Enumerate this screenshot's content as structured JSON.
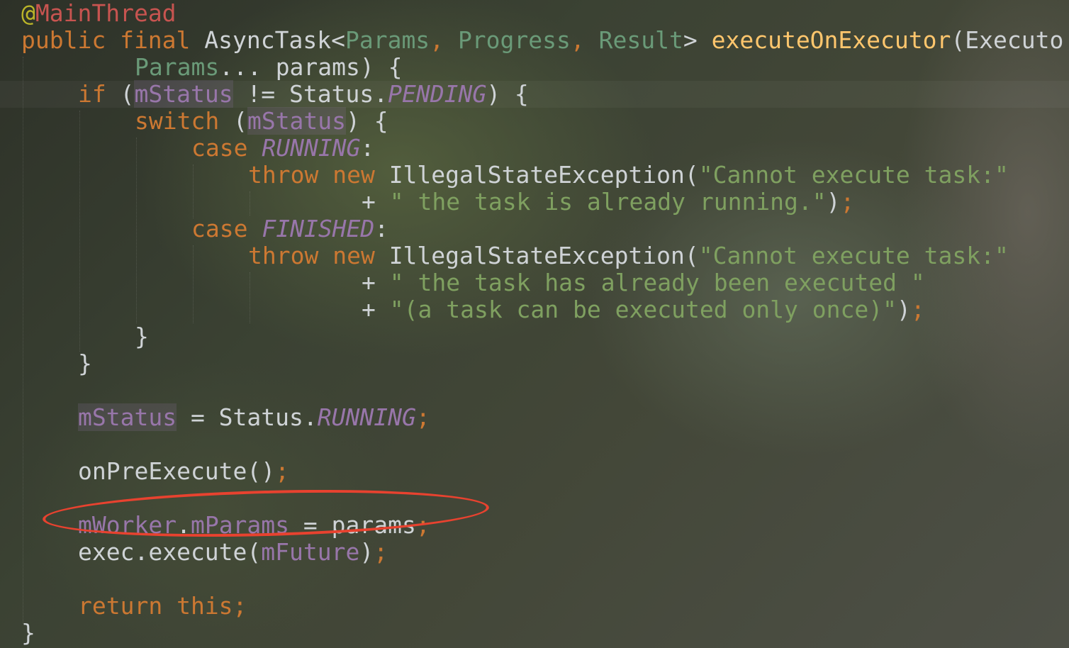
{
  "code": {
    "annotation_at": "@",
    "annotation_name": "MainThread",
    "l2": {
      "kw1": "public final ",
      "type": "AsyncTask<",
      "g1": "Params",
      "c1": ", ",
      "g2": "Progress",
      "c2": ", ",
      "g3": "Result",
      "close": "> ",
      "method": "executeOnExecutor",
      "rest": "(Executo"
    },
    "l3": {
      "g": "Params",
      "rest": "... params) {"
    },
    "l4": {
      "kw": "if ",
      "p1": "(",
      "field": "mStatus",
      "mid": " != Status.",
      "const": "PENDING",
      "end": ") {"
    },
    "l5": {
      "kw": "switch ",
      "p1": "(",
      "field": "mStatus",
      "end": ") {"
    },
    "l6": {
      "kw": "case ",
      "const": "RUNNING",
      "end": ":"
    },
    "l7": {
      "kw": "throw new ",
      "type": "IllegalStateException(",
      "str": "\"Cannot execute task:\""
    },
    "l8": {
      "plus": "+ ",
      "str": "\" the task is already running.\"",
      "end": ")",
      "semi": ";"
    },
    "l9": {
      "kw": "case ",
      "const": "FINISHED",
      "end": ":"
    },
    "l10": {
      "kw": "throw new ",
      "type": "IllegalStateException(",
      "str": "\"Cannot execute task:\""
    },
    "l11": {
      "plus": "+ ",
      "str": "\" the task has already been executed \""
    },
    "l12": {
      "plus": "+ ",
      "str": "\"(a task can be executed only once)\"",
      "end": ")",
      "semi": ";"
    },
    "l13": "}",
    "l14": "}",
    "l15": {
      "field": "mStatus",
      "mid": " = Status.",
      "const": "RUNNING",
      "semi": ";"
    },
    "l16": {
      "text": "onPreExecute()",
      "semi": ";"
    },
    "l17": {
      "field1": "mWorker",
      "dot": ".",
      "field2": "mParams",
      "mid": " = params",
      "semi": ";"
    },
    "l18": {
      "text": "exec.execute(",
      "field": "mFuture",
      "end": ")",
      "semi": ";"
    },
    "l19": {
      "kw": "return this",
      "semi": ";"
    },
    "l20": "}"
  },
  "colors": {
    "keyword": "#cc7832",
    "field": "#9876aa",
    "string": "#7fa060",
    "method": "#ffc66d",
    "generic": "#6a9a78",
    "annotation": "#c75450",
    "highlight_circle": "#e8422f"
  }
}
